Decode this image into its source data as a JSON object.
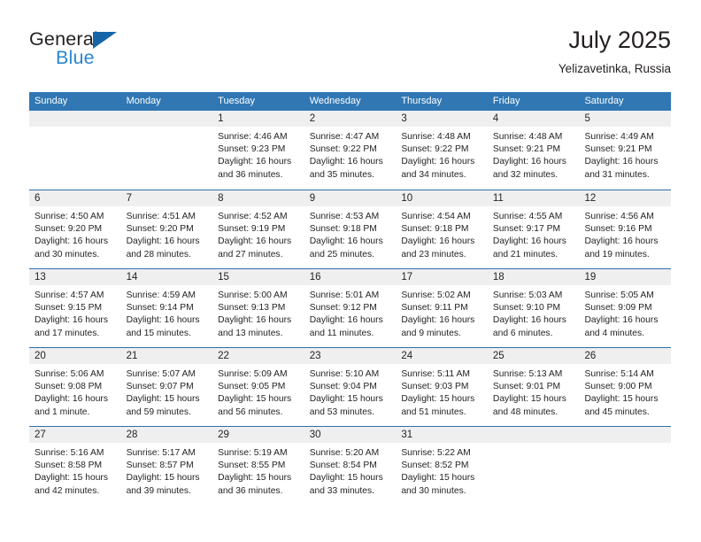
{
  "brand": {
    "name_top": "General",
    "name_bottom": "Blue",
    "accent_color": "#2a85d0",
    "triangle_color": "#1565a8"
  },
  "header": {
    "title": "July 2025",
    "subtitle": "Yelizavetinka, Russia"
  },
  "theme": {
    "header_row_bg": "#3077b4",
    "week_separator": "#2f6fa8",
    "day_band_bg": "#efefef",
    "text_color": "#231f20"
  },
  "weekday_headers": [
    "Sunday",
    "Monday",
    "Tuesday",
    "Wednesday",
    "Thursday",
    "Friday",
    "Saturday"
  ],
  "weeks": [
    [
      {
        "day": "",
        "sunrise": "",
        "sunset": "",
        "daylight_line1": "",
        "daylight_line2": ""
      },
      {
        "day": "",
        "sunrise": "",
        "sunset": "",
        "daylight_line1": "",
        "daylight_line2": ""
      },
      {
        "day": "1",
        "sunrise": "Sunrise: 4:46 AM",
        "sunset": "Sunset: 9:23 PM",
        "daylight_line1": "Daylight: 16 hours",
        "daylight_line2": "and 36 minutes."
      },
      {
        "day": "2",
        "sunrise": "Sunrise: 4:47 AM",
        "sunset": "Sunset: 9:22 PM",
        "daylight_line1": "Daylight: 16 hours",
        "daylight_line2": "and 35 minutes."
      },
      {
        "day": "3",
        "sunrise": "Sunrise: 4:48 AM",
        "sunset": "Sunset: 9:22 PM",
        "daylight_line1": "Daylight: 16 hours",
        "daylight_line2": "and 34 minutes."
      },
      {
        "day": "4",
        "sunrise": "Sunrise: 4:48 AM",
        "sunset": "Sunset: 9:21 PM",
        "daylight_line1": "Daylight: 16 hours",
        "daylight_line2": "and 32 minutes."
      },
      {
        "day": "5",
        "sunrise": "Sunrise: 4:49 AM",
        "sunset": "Sunset: 9:21 PM",
        "daylight_line1": "Daylight: 16 hours",
        "daylight_line2": "and 31 minutes."
      }
    ],
    [
      {
        "day": "6",
        "sunrise": "Sunrise: 4:50 AM",
        "sunset": "Sunset: 9:20 PM",
        "daylight_line1": "Daylight: 16 hours",
        "daylight_line2": "and 30 minutes."
      },
      {
        "day": "7",
        "sunrise": "Sunrise: 4:51 AM",
        "sunset": "Sunset: 9:20 PM",
        "daylight_line1": "Daylight: 16 hours",
        "daylight_line2": "and 28 minutes."
      },
      {
        "day": "8",
        "sunrise": "Sunrise: 4:52 AM",
        "sunset": "Sunset: 9:19 PM",
        "daylight_line1": "Daylight: 16 hours",
        "daylight_line2": "and 27 minutes."
      },
      {
        "day": "9",
        "sunrise": "Sunrise: 4:53 AM",
        "sunset": "Sunset: 9:18 PM",
        "daylight_line1": "Daylight: 16 hours",
        "daylight_line2": "and 25 minutes."
      },
      {
        "day": "10",
        "sunrise": "Sunrise: 4:54 AM",
        "sunset": "Sunset: 9:18 PM",
        "daylight_line1": "Daylight: 16 hours",
        "daylight_line2": "and 23 minutes."
      },
      {
        "day": "11",
        "sunrise": "Sunrise: 4:55 AM",
        "sunset": "Sunset: 9:17 PM",
        "daylight_line1": "Daylight: 16 hours",
        "daylight_line2": "and 21 minutes."
      },
      {
        "day": "12",
        "sunrise": "Sunrise: 4:56 AM",
        "sunset": "Sunset: 9:16 PM",
        "daylight_line1": "Daylight: 16 hours",
        "daylight_line2": "and 19 minutes."
      }
    ],
    [
      {
        "day": "13",
        "sunrise": "Sunrise: 4:57 AM",
        "sunset": "Sunset: 9:15 PM",
        "daylight_line1": "Daylight: 16 hours",
        "daylight_line2": "and 17 minutes."
      },
      {
        "day": "14",
        "sunrise": "Sunrise: 4:59 AM",
        "sunset": "Sunset: 9:14 PM",
        "daylight_line1": "Daylight: 16 hours",
        "daylight_line2": "and 15 minutes."
      },
      {
        "day": "15",
        "sunrise": "Sunrise: 5:00 AM",
        "sunset": "Sunset: 9:13 PM",
        "daylight_line1": "Daylight: 16 hours",
        "daylight_line2": "and 13 minutes."
      },
      {
        "day": "16",
        "sunrise": "Sunrise: 5:01 AM",
        "sunset": "Sunset: 9:12 PM",
        "daylight_line1": "Daylight: 16 hours",
        "daylight_line2": "and 11 minutes."
      },
      {
        "day": "17",
        "sunrise": "Sunrise: 5:02 AM",
        "sunset": "Sunset: 9:11 PM",
        "daylight_line1": "Daylight: 16 hours",
        "daylight_line2": "and 9 minutes."
      },
      {
        "day": "18",
        "sunrise": "Sunrise: 5:03 AM",
        "sunset": "Sunset: 9:10 PM",
        "daylight_line1": "Daylight: 16 hours",
        "daylight_line2": "and 6 minutes."
      },
      {
        "day": "19",
        "sunrise": "Sunrise: 5:05 AM",
        "sunset": "Sunset: 9:09 PM",
        "daylight_line1": "Daylight: 16 hours",
        "daylight_line2": "and 4 minutes."
      }
    ],
    [
      {
        "day": "20",
        "sunrise": "Sunrise: 5:06 AM",
        "sunset": "Sunset: 9:08 PM",
        "daylight_line1": "Daylight: 16 hours",
        "daylight_line2": "and 1 minute."
      },
      {
        "day": "21",
        "sunrise": "Sunrise: 5:07 AM",
        "sunset": "Sunset: 9:07 PM",
        "daylight_line1": "Daylight: 15 hours",
        "daylight_line2": "and 59 minutes."
      },
      {
        "day": "22",
        "sunrise": "Sunrise: 5:09 AM",
        "sunset": "Sunset: 9:05 PM",
        "daylight_line1": "Daylight: 15 hours",
        "daylight_line2": "and 56 minutes."
      },
      {
        "day": "23",
        "sunrise": "Sunrise: 5:10 AM",
        "sunset": "Sunset: 9:04 PM",
        "daylight_line1": "Daylight: 15 hours",
        "daylight_line2": "and 53 minutes."
      },
      {
        "day": "24",
        "sunrise": "Sunrise: 5:11 AM",
        "sunset": "Sunset: 9:03 PM",
        "daylight_line1": "Daylight: 15 hours",
        "daylight_line2": "and 51 minutes."
      },
      {
        "day": "25",
        "sunrise": "Sunrise: 5:13 AM",
        "sunset": "Sunset: 9:01 PM",
        "daylight_line1": "Daylight: 15 hours",
        "daylight_line2": "and 48 minutes."
      },
      {
        "day": "26",
        "sunrise": "Sunrise: 5:14 AM",
        "sunset": "Sunset: 9:00 PM",
        "daylight_line1": "Daylight: 15 hours",
        "daylight_line2": "and 45 minutes."
      }
    ],
    [
      {
        "day": "27",
        "sunrise": "Sunrise: 5:16 AM",
        "sunset": "Sunset: 8:58 PM",
        "daylight_line1": "Daylight: 15 hours",
        "daylight_line2": "and 42 minutes."
      },
      {
        "day": "28",
        "sunrise": "Sunrise: 5:17 AM",
        "sunset": "Sunset: 8:57 PM",
        "daylight_line1": "Daylight: 15 hours",
        "daylight_line2": "and 39 minutes."
      },
      {
        "day": "29",
        "sunrise": "Sunrise: 5:19 AM",
        "sunset": "Sunset: 8:55 PM",
        "daylight_line1": "Daylight: 15 hours",
        "daylight_line2": "and 36 minutes."
      },
      {
        "day": "30",
        "sunrise": "Sunrise: 5:20 AM",
        "sunset": "Sunset: 8:54 PM",
        "daylight_line1": "Daylight: 15 hours",
        "daylight_line2": "and 33 minutes."
      },
      {
        "day": "31",
        "sunrise": "Sunrise: 5:22 AM",
        "sunset": "Sunset: 8:52 PM",
        "daylight_line1": "Daylight: 15 hours",
        "daylight_line2": "and 30 minutes."
      },
      {
        "day": "",
        "sunrise": "",
        "sunset": "",
        "daylight_line1": "",
        "daylight_line2": ""
      },
      {
        "day": "",
        "sunrise": "",
        "sunset": "",
        "daylight_line1": "",
        "daylight_line2": ""
      }
    ]
  ]
}
